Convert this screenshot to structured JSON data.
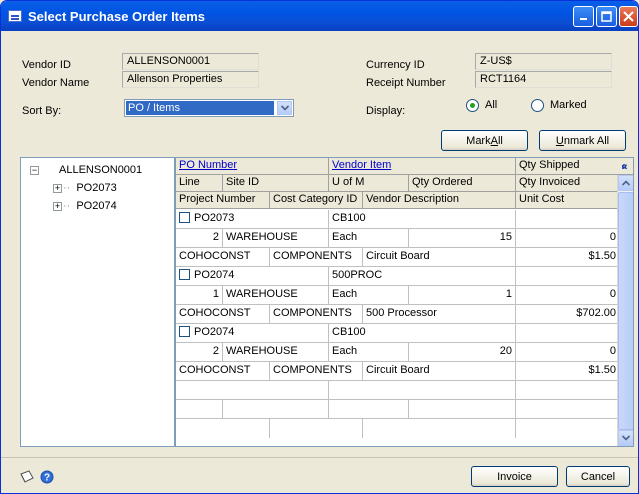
{
  "window": {
    "title": "Select Purchase Order Items",
    "icon": "window-list-icon",
    "accent": "#0054e3"
  },
  "header": {
    "vendor_id_label": "Vendor ID",
    "vendor_id": "ALLENSON0001",
    "vendor_name_label": "Vendor Name",
    "vendor_name": "Allenson Properties",
    "currency_label": "Currency ID",
    "currency": "Z-US$",
    "receipt_label": "Receipt Number",
    "receipt": "RCT1164",
    "sort_label": "Sort By:",
    "sort_value": "PO / Items",
    "display_label": "Display:",
    "display_all": "All",
    "display_marked": "Marked",
    "display_selected": "All"
  },
  "buttons": {
    "mark_all_pre": "Mark ",
    "mark_all_u": "A",
    "mark_all_post": "ll",
    "unmark_pre": "",
    "unmark_u": "U",
    "unmark_post": "nmark All",
    "invoice": "Invoice",
    "cancel": "Cancel"
  },
  "tree": {
    "root": "ALLENSON0001",
    "children": [
      "PO2073",
      "PO2074"
    ]
  },
  "grid": {
    "header1": [
      "PO Number",
      "Vendor Item",
      "Qty Shipped"
    ],
    "header2": [
      "Line",
      "Site ID",
      "U of M",
      "Qty Ordered",
      "Qty Invoiced"
    ],
    "header3": [
      "Project Number",
      "Cost Category ID",
      "Vendor Description",
      "Unit Cost"
    ],
    "rows": [
      {
        "po": "PO2073",
        "item": "CB100",
        "line": "2",
        "site": "WAREHOUSE",
        "uom": "Each",
        "ordered": "15",
        "invoiced": "0",
        "project": "COHOCONST",
        "category": "COMPONENTS",
        "desc": "Circuit Board",
        "cost": "$1.50"
      },
      {
        "po": "PO2074",
        "item": "500PROC",
        "line": "1",
        "site": "WAREHOUSE",
        "uom": "Each",
        "ordered": "1",
        "invoiced": "0",
        "project": "COHOCONST",
        "category": "COMPONENTS",
        "desc": "500 Processor",
        "cost": "$702.00"
      },
      {
        "po": "PO2074",
        "item": "CB100",
        "line": "2",
        "site": "WAREHOUSE",
        "uom": "Each",
        "ordered": "20",
        "invoiced": "0",
        "project": "COHOCONST",
        "category": "COMPONENTS",
        "desc": "Circuit Board",
        "cost": "$1.50"
      }
    ]
  },
  "footer": {
    "icons": [
      "note-icon",
      "help-icon"
    ]
  }
}
